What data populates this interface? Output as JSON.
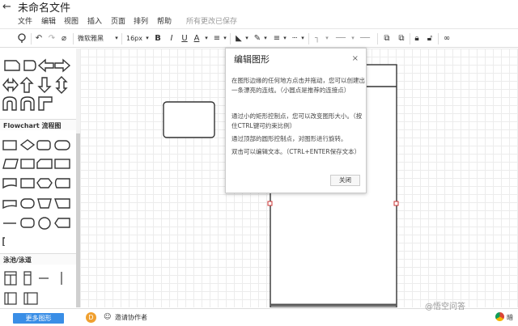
{
  "app": {
    "title": "未命名文件",
    "saved_status": "所有更改已保存"
  },
  "menu": [
    "文件",
    "编辑",
    "视图",
    "插入",
    "页面",
    "排列",
    "帮助"
  ],
  "toolbar": {
    "font_name": "微软雅黑",
    "font_size": "16px",
    "bold": "B",
    "italic": "I",
    "underline": "U",
    "font_color": "A",
    "line_color": "A"
  },
  "sidebar": {
    "flowchart_section": "Flowchart 流程图",
    "swimlane_section": "泳池/泳道",
    "more_shapes": "更多图形"
  },
  "bottom": {
    "avatar_letter": "D",
    "invite": "邀请协作者",
    "watermark": "@悟空问答",
    "browser_fragment": "暗"
  },
  "dialog": {
    "title": "编辑图形",
    "close_x": "×",
    "p1": "在图形边缘的任何地方点击并拖动，您可以创建出一条漂亮的连线。（小圆点是推荐的连接点）",
    "p2": "通过小的矩形控制点，您可以改变图形大小。（按住CTRL键可约束比例）",
    "p3": "通过顶部的圆形控制点，对图形进行旋转。",
    "p4": "双击可以编辑文本。（CTRL+ENTER保存文本）",
    "close_button": "关闭"
  },
  "colors": {
    "accent": "#3a8ee6",
    "grid": "#ececec",
    "selection": "#333333",
    "handle": "#cc3333"
  }
}
